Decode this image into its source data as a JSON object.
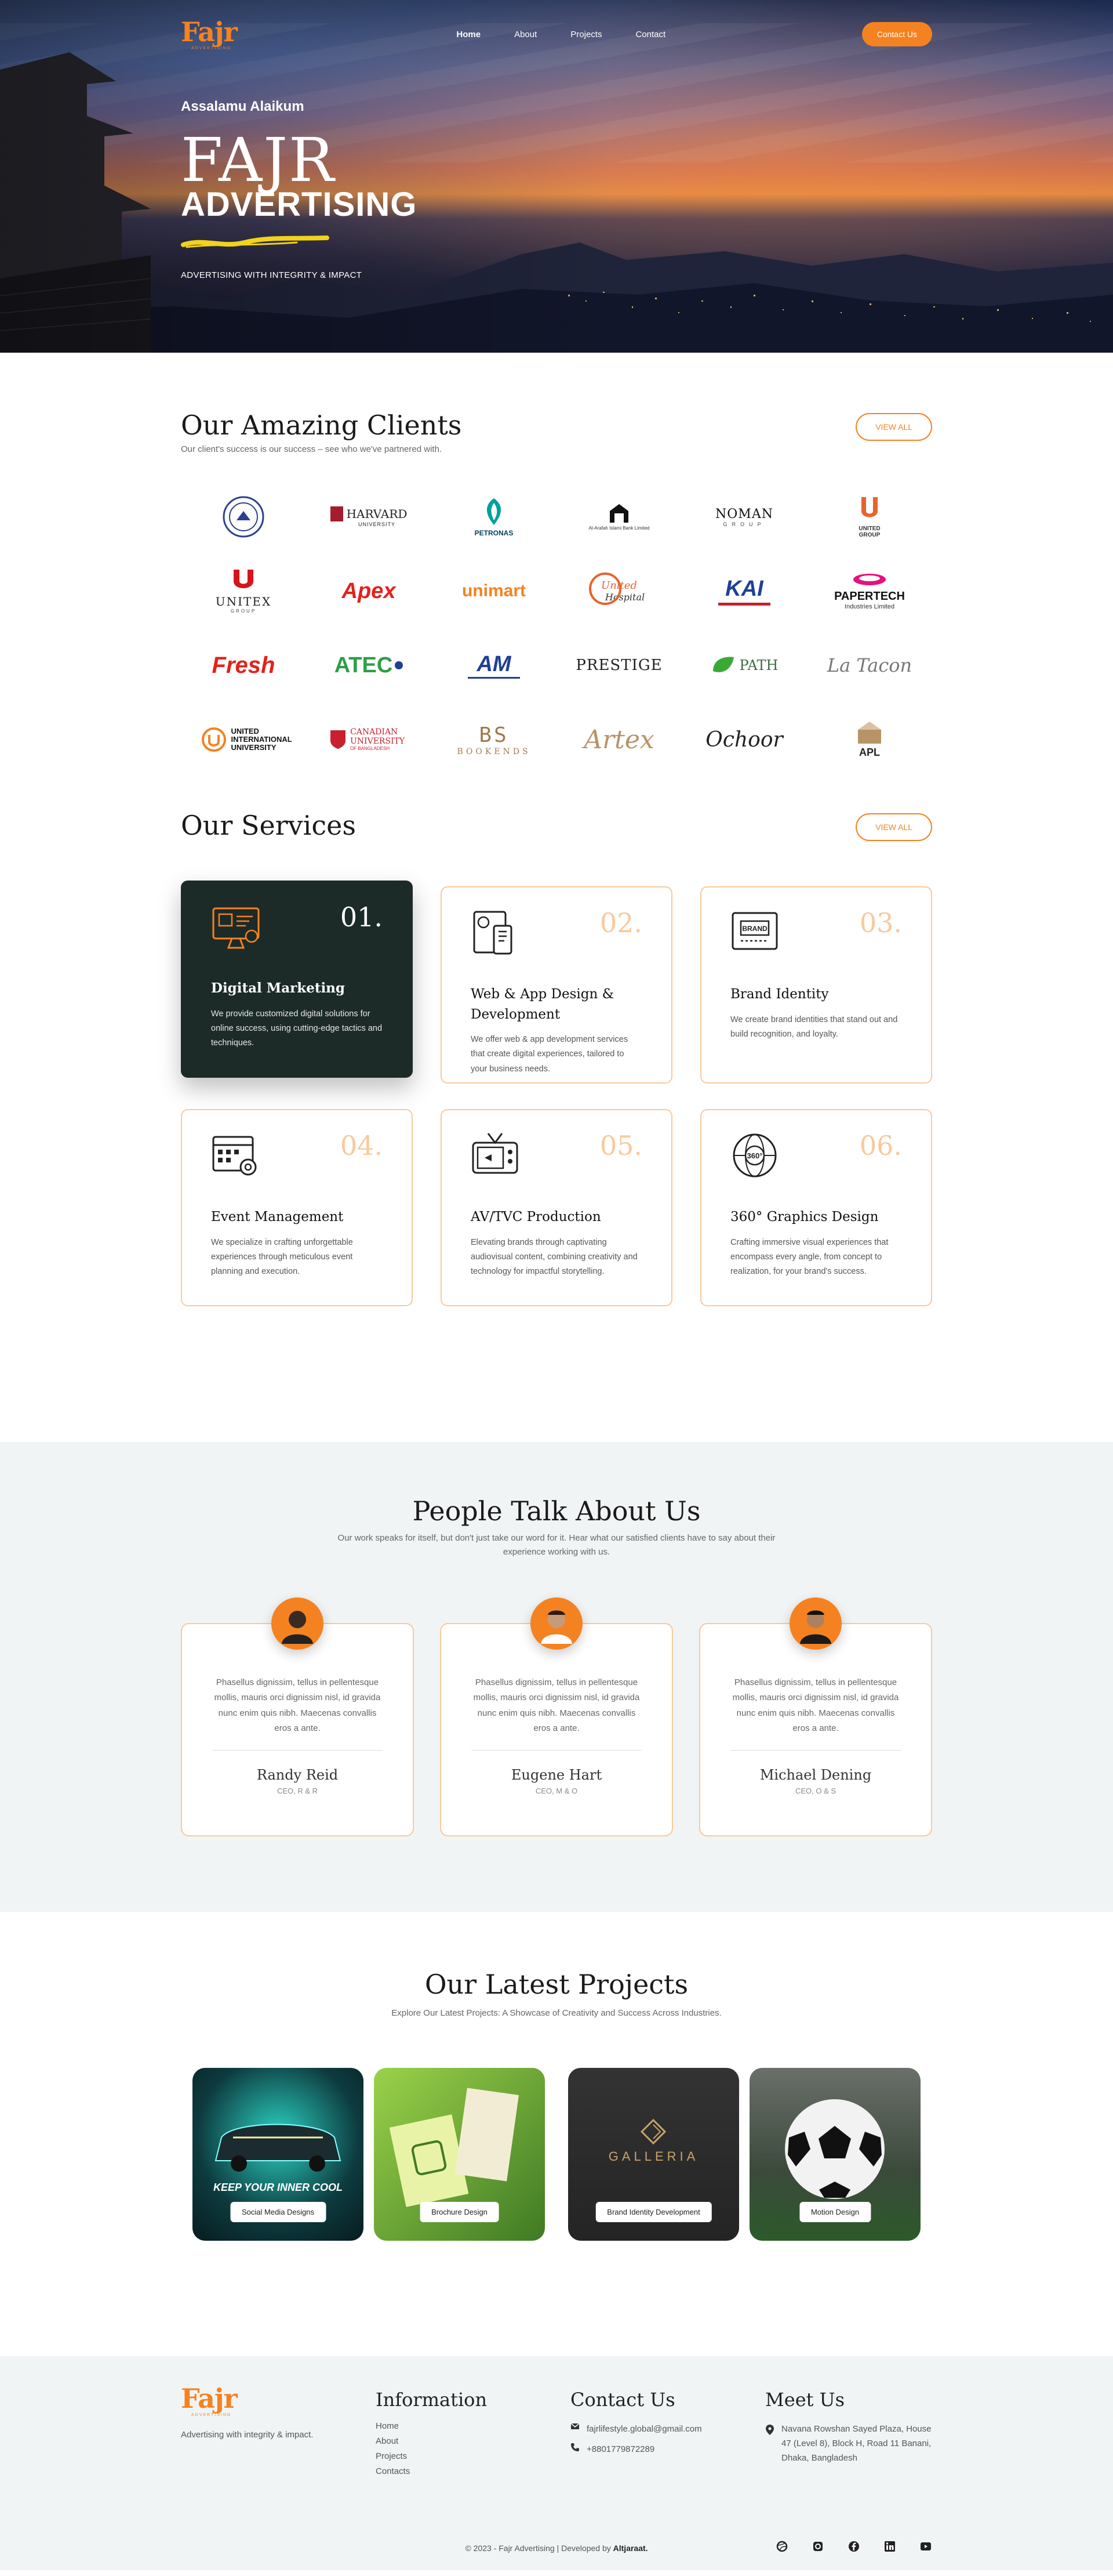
{
  "brand": {
    "name": "Fajr",
    "tagline": "ADVERTISING"
  },
  "nav": {
    "items": [
      {
        "label": "Home"
      },
      {
        "label": "About"
      },
      {
        "label": "Projects"
      },
      {
        "label": "Contact"
      }
    ],
    "cta": "Contact Us"
  },
  "hero": {
    "greeting": "Assalamu Alaikum",
    "title_line1": "FAJR",
    "title_line2": "ADVERTISING",
    "tagline": "ADVERTISING WITH INTEGRITY & IMPACT"
  },
  "clients": {
    "title": "Our Amazing Clients",
    "subtitle": "Our client's success is our success – see who we've partnered with.",
    "view_all": "VIEW ALL",
    "logos": [
      {
        "text": "",
        "icon": "university-seal-icon"
      },
      {
        "text": "HARVARD",
        "sub": "UNIVERSITY"
      },
      {
        "text": "PETRONAS"
      },
      {
        "text": "Al-Arafah Islami Bank Limited"
      },
      {
        "text": "NOMAN",
        "sub": "GROUP"
      },
      {
        "text": "UNITED",
        "sub": "GROUP"
      },
      {
        "text": "UNITEX",
        "sub": "GROUP"
      },
      {
        "text": "Apex"
      },
      {
        "text": "unimart"
      },
      {
        "text": "United",
        "sub": "Hospital"
      },
      {
        "text": "KAI"
      },
      {
        "text": "PAPERTECH",
        "sub": "Industries Limited"
      },
      {
        "text": "Fresh"
      },
      {
        "text": "ATEC"
      },
      {
        "text": "AM"
      },
      {
        "text": "PRESTIGE"
      },
      {
        "text": "PATH"
      },
      {
        "text": "La Tacon"
      },
      {
        "text": "UNITED INTERNATIONAL UNIVERSITY"
      },
      {
        "text": "CANADIAN UNIVERSITY",
        "sub": "OF BANGLADESH"
      },
      {
        "text": "BOOKENDS"
      },
      {
        "text": "Artex"
      },
      {
        "text": "Ochoor"
      },
      {
        "text": "APL"
      }
    ]
  },
  "services": {
    "title": "Our Services",
    "view_all": "VIEW ALL",
    "items": [
      {
        "num": "01.",
        "title": "Digital Marketing",
        "desc": "We provide customized digital solutions for online success, using cutting-edge tactics and techniques.",
        "icon": "digital-marketing-icon"
      },
      {
        "num": "02.",
        "title": "Web & App Design & Development",
        "desc": "We offer web & app development services that create digital experiences, tailored to your business needs.",
        "icon": "web-app-icon"
      },
      {
        "num": "03.",
        "title": "Brand Identity",
        "desc": "We create brand identities that stand out and build recognition, and loyalty.",
        "icon": "brand-icon"
      },
      {
        "num": "04.",
        "title": "Event Management",
        "desc": "We specialize in crafting unforgettable experiences through meticulous event planning and execution.",
        "icon": "event-calendar-icon"
      },
      {
        "num": "05.",
        "title": "AV/TVC Production",
        "desc": "Elevating brands through captivating audiovisual content, combining creativity and technology for impactful storytelling.",
        "icon": "tv-icon"
      },
      {
        "num": "06.",
        "title": "360° Graphics Design",
        "desc": "Crafting immersive visual experiences that encompass every angle, from concept to realization, for your brand's success.",
        "icon": "globe-360-icon"
      }
    ]
  },
  "testimonials": {
    "title": "People Talk About Us",
    "subtitle": "Our work speaks for itself, but don't just take our word for it. Hear what our satisfied clients have to say about their experience working with us.",
    "items": [
      {
        "quote": "Phasellus dignissim, tellus in pellentesque mollis, mauris orci dignissim nisl, id gravida nunc enim quis nibh. Maecenas convallis eros a ante.",
        "name": "Randy Reid",
        "role": "CEO, R & R"
      },
      {
        "quote": "Phasellus dignissim, tellus in pellentesque mollis, mauris orci dignissim nisl, id gravida nunc enim quis nibh. Maecenas convallis eros a ante.",
        "name": "Eugene Hart",
        "role": "CEO, M & O"
      },
      {
        "quote": "Phasellus dignissim, tellus in pellentesque mollis, mauris orci dignissim nisl, id gravida nunc enim quis nibh. Maecenas convallis eros a ante.",
        "name": "Michael Dening",
        "role": "CEO, O & S"
      }
    ]
  },
  "projects": {
    "title": "Our Latest Projects",
    "subtitle": "Explore Our Latest Projects: A Showcase of Creativity and Success Across Industries.",
    "items": [
      {
        "label": "Social Media Designs",
        "art_text": "KEEP YOUR INNER COOL"
      },
      {
        "label": "Brochure Design"
      },
      {
        "label": "Brand Identity Development",
        "art_text": "GALLERIA"
      },
      {
        "label": "Motion Design"
      }
    ]
  },
  "footer": {
    "tagline": "Advertising with integrity & impact.",
    "info_title": "Information",
    "links": [
      "Home",
      "About",
      "Projects",
      "Contacts"
    ],
    "contact_title": "Contact Us",
    "email": "fajrlifestyle.global@gmail.com",
    "phone": "+8801779872289",
    "meet_title": "Meet Us",
    "address": "Navana Rowshan Sayed Plaza, House 47 (Level 8), Block H, Road 11 Banani, Dhaka, Bangladesh",
    "copyright": "© 2023 - Fajr Advertising | Developed by",
    "developer": "Altjaraat."
  },
  "colors": {
    "accent": "#f58220",
    "dark_card": "#1c2b28",
    "border": "#f9c99c",
    "section_bg": "#f1f4f4"
  }
}
